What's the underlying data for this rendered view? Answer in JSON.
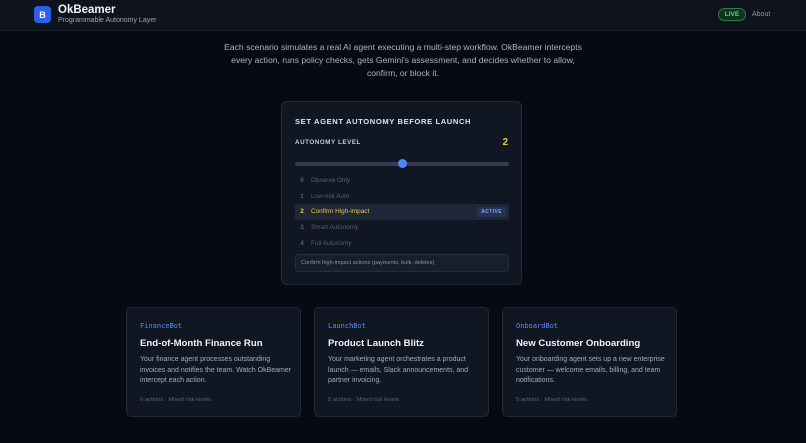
{
  "header": {
    "logo_letter": "B",
    "title": "OkBeamer",
    "subtitle": "Programmable Autonomy Layer",
    "live_badge": "LIVE",
    "about_link": "About"
  },
  "intro": {
    "text": "Each scenario simulates a real AI agent executing a multi-step workflow. OkBeamer intercepts every action, runs policy checks, gets Gemini's assessment, and decides whether to allow, confirm, or block it."
  },
  "autonomy_panel": {
    "title": "SET AGENT AUTONOMY BEFORE LAUNCH",
    "level_label": "AUTONOMY LEVEL",
    "current_level": "2",
    "slider_fraction": 0.5,
    "options": [
      {
        "num": "0",
        "label": "Observe Only"
      },
      {
        "num": "1",
        "label": "Low-risk Auto"
      },
      {
        "num": "2",
        "label": "Confirm High-impact",
        "active": true
      },
      {
        "num": "3",
        "label": "Smart Autonomy"
      },
      {
        "num": "4",
        "label": "Full Autonomy"
      }
    ],
    "active_tag": "ACTIVE",
    "description": "Confirm high-impact actions (payments, bulk, deletes)"
  },
  "scenarios": [
    {
      "agent": "FinanceBot",
      "title": "End-of-Month Finance Run",
      "description": "Your finance agent processes outstanding invoices and notifies the team. Watch OkBeamer intercept each action.",
      "meta": "6 actions · Mixed risk levels"
    },
    {
      "agent": "LaunchBot",
      "title": "Product Launch Blitz",
      "description": "Your marketing agent orchestrates a product launch — emails, Slack announcements, and partner invoicing.",
      "meta": "5 actions · Mixed risk levels"
    },
    {
      "agent": "OnboardBot",
      "title": "New Customer Onboarding",
      "description": "Your onboarding agent sets up a new enterprise customer — welcome emails, billing, and team notifications.",
      "meta": "5 actions · Mixed risk levels"
    }
  ],
  "colors": {
    "accent_blue": "#4a86f5",
    "level_yellow": "#f5c542",
    "live_green": "#4ade80"
  }
}
